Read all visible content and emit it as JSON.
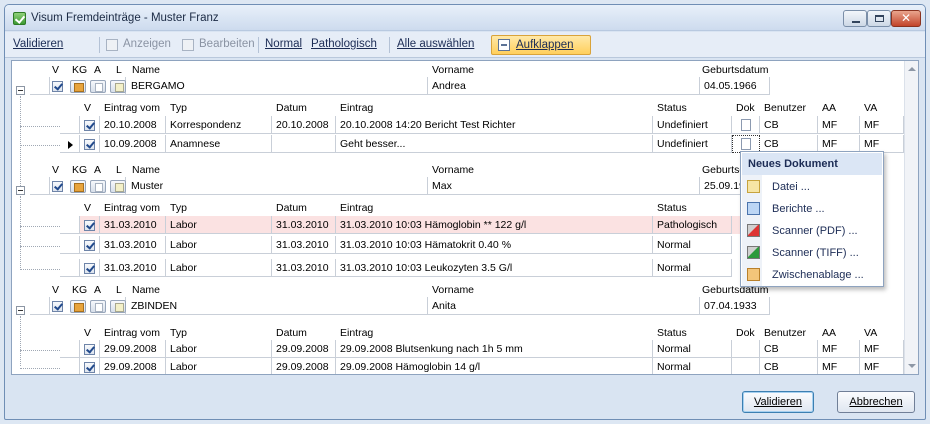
{
  "window": {
    "title": "Visum Fremdeinträge - Muster Franz"
  },
  "toolbar": {
    "validieren": "Validieren",
    "anzeigen": "Anzeigen",
    "bearbeiten": "Bearbeiten",
    "normal": "Normal",
    "pathologisch": "Pathologisch",
    "alle_auswaehlen": "Alle auswählen",
    "aufklappen": "Aufklappen"
  },
  "patient_headers": {
    "v": "V",
    "kg": "KG",
    "a": "A",
    "l": "L",
    "name": "Name",
    "vorname": "Vorname",
    "geburtsdatum": "Geburtsdatum"
  },
  "entry_headers": {
    "v": "V",
    "eintrag_vom": "Eintrag vom",
    "typ": "Typ",
    "datum": "Datum",
    "eintrag": "Eintrag",
    "status": "Status",
    "dok": "Dok",
    "benutzer": "Benutzer",
    "aa": "AA",
    "va": "VA"
  },
  "patients": [
    {
      "name": "BERGAMO",
      "vorname": "Andrea",
      "geburtsdatum": "04.05.1966",
      "entries": [
        {
          "eintrag_vom": "20.10.2008",
          "typ": "Korrespondenz",
          "datum": "20.10.2008",
          "eintrag": "20.10.2008 14:20 Bericht Test Richter",
          "status": "Undefiniert",
          "benutzer": "CB",
          "aa": "MF",
          "va": "MF"
        },
        {
          "eintrag_vom": "10.09.2008",
          "typ": "Anamnese",
          "datum": "",
          "eintrag": "Geht besser...",
          "status": "Undefiniert",
          "benutzer": "CB",
          "aa": "MF",
          "va": "MF"
        }
      ]
    },
    {
      "name": "Muster",
      "vorname": "Max",
      "geburtsdatum": "25.09.19",
      "entries": [
        {
          "eintrag_vom": "31.03.2010",
          "typ": "Labor",
          "datum": "31.03.2010",
          "eintrag": "31.03.2010 10:03 Hämoglobin ** 122 g/l",
          "status": "Pathologisch"
        },
        {
          "eintrag_vom": "31.03.2010",
          "typ": "Labor",
          "datum": "31.03.2010",
          "eintrag": "31.03.2010 10:03 Hämatokrit 0.40 %",
          "status": "Normal"
        },
        {
          "eintrag_vom": "31.03.2010",
          "typ": "Labor",
          "datum": "31.03.2010",
          "eintrag": "31.03.2010 10:03 Leukozyten 3.5 G/l",
          "status": "Normal"
        }
      ]
    },
    {
      "name": "ZBINDEN",
      "vorname": "Anita",
      "geburtsdatum": "07.04.1933",
      "entries": [
        {
          "eintrag_vom": "29.09.2008",
          "typ": "Labor",
          "datum": "29.09.2008",
          "eintrag": "29.09.2008 Blutsenkung nach 1h 5 mm",
          "status": "Normal",
          "benutzer": "CB",
          "aa": "MF",
          "va": "MF"
        },
        {
          "eintrag_vom": "29.09.2008",
          "typ": "Labor",
          "datum": "29.09.2008",
          "eintrag": "29.09.2008 Hämoglobin 14 g/l",
          "status": "Normal",
          "benutzer": "CB",
          "aa": "MF",
          "va": "MF"
        }
      ]
    }
  ],
  "popup": {
    "title": "Neues Dokument",
    "items": [
      "Datei ...",
      "Berichte ...",
      "Scanner (PDF) ...",
      "Scanner (TIFF) ...",
      "Zwischenablage ..."
    ]
  },
  "buttons": {
    "validieren": "Validieren",
    "abbrechen": "Abbrechen"
  },
  "colors": {
    "pathological_row": "#fbe2e2",
    "active_button": "#ffd56b"
  }
}
